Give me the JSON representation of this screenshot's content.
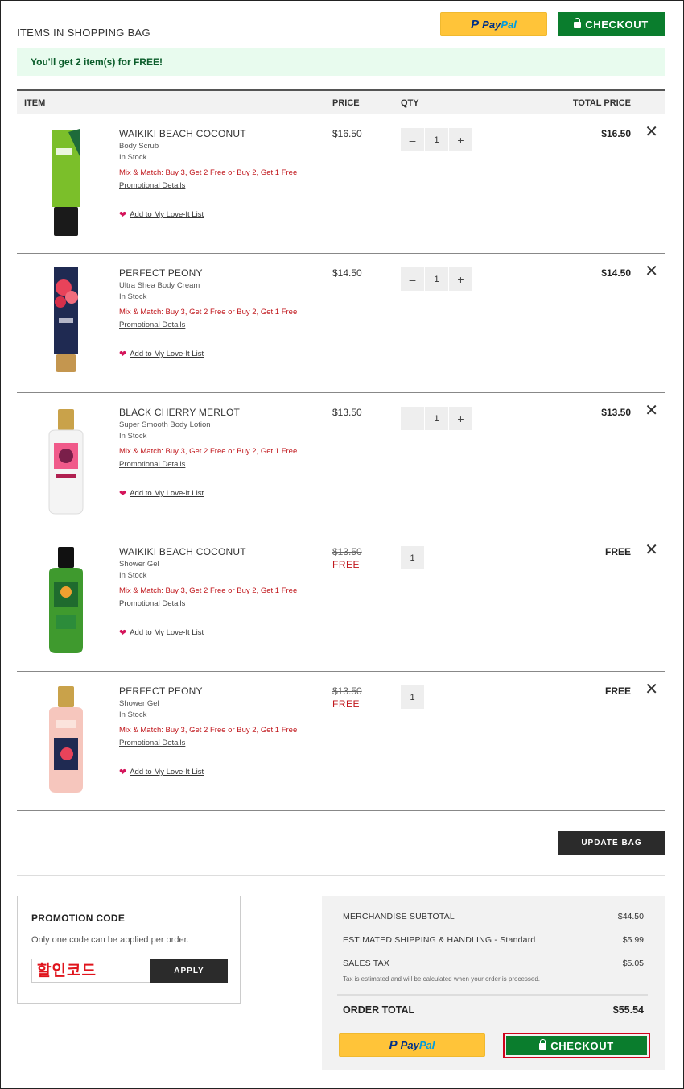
{
  "header": {
    "title": "ITEMS IN SHOPPING BAG",
    "paypal_label_pay": "Pay",
    "paypal_label_pal": "Pal",
    "checkout_label": "CHECKOUT"
  },
  "banner": {
    "text": "You'll get 2 item(s) for FREE!"
  },
  "table": {
    "col_item": "ITEM",
    "col_price": "PRICE",
    "col_qty": "QTY",
    "col_total": "TOTAL PRICE"
  },
  "items": [
    {
      "name": "WAIKIKI BEACH COCONUT",
      "type": "Body Scrub",
      "stock": "In Stock",
      "promo": "Mix & Match: Buy 3, Get 2 Free or Buy 2, Get 1 Free",
      "details": "Promotional Details",
      "love": "Add to My Love-It List",
      "price": "$16.50",
      "qty": "1",
      "total": "$16.50",
      "color": "#7bbf2a"
    },
    {
      "name": "PERFECT PEONY",
      "type": "Ultra Shea Body Cream",
      "stock": "In Stock",
      "promo": "Mix & Match: Buy 3, Get 2 Free or Buy 2, Get 1 Free",
      "details": "Promotional Details",
      "love": "Add to My Love-It List",
      "price": "$14.50",
      "qty": "1",
      "total": "$14.50",
      "color": "#1f2a52"
    },
    {
      "name": "BLACK CHERRY MERLOT",
      "type": "Super Smooth Body Lotion",
      "stock": "In Stock",
      "promo": "Mix & Match: Buy 3, Get 2 Free or Buy 2, Get 1 Free",
      "details": "Promotional Details",
      "love": "Add to My Love-It List",
      "price": "$13.50",
      "qty": "1",
      "total": "$13.50",
      "color": "#f4f4f4"
    },
    {
      "name": "WAIKIKI BEACH COCONUT",
      "type": "Shower Gel",
      "stock": "In Stock",
      "promo": "Mix & Match: Buy 3, Get 2 Free or Buy 2, Get 1 Free",
      "details": "Promotional Details",
      "love": "Add to My Love-It List",
      "price_old": "$13.50",
      "price_free": "FREE",
      "qty": "1",
      "total": "FREE",
      "color": "#3f9a2e"
    },
    {
      "name": "PERFECT PEONY",
      "type": "Shower Gel",
      "stock": "In Stock",
      "promo": "Mix & Match: Buy 3, Get 2 Free or Buy 2, Get 1 Free",
      "details": "Promotional Details",
      "love": "Add to My Love-It List",
      "price_old": "$13.50",
      "price_free": "FREE",
      "qty": "1",
      "total": "FREE",
      "color": "#f6c6bd"
    }
  ],
  "update_bag": "UPDATE BAG",
  "promo": {
    "title": "PROMOTION CODE",
    "note": "Only one code can be applied per order.",
    "input_value": "할인코드",
    "apply": "APPLY"
  },
  "summary": {
    "subtotal_label": "MERCHANDISE SUBTOTAL",
    "subtotal_value": "$44.50",
    "shipping_label": "ESTIMATED SHIPPING & HANDLING - Standard",
    "shipping_value": "$5.99",
    "tax_label": "SALES TAX",
    "tax_value": "$5.05",
    "tax_note": "Tax is estimated and will be calculated when your order is processed.",
    "total_label": "ORDER TOTAL",
    "total_value": "$55.54",
    "checkout_label": "CHECKOUT"
  },
  "colors": {
    "checkout_green": "#0a7d2d",
    "paypal_yellow": "#ffc439",
    "promo_red": "#c0161b",
    "banner_bg": "#e8fbee"
  },
  "icons": [
    "lock-icon",
    "heart-icon",
    "close-icon",
    "minus-icon",
    "plus-icon",
    "paypal-logo"
  ]
}
